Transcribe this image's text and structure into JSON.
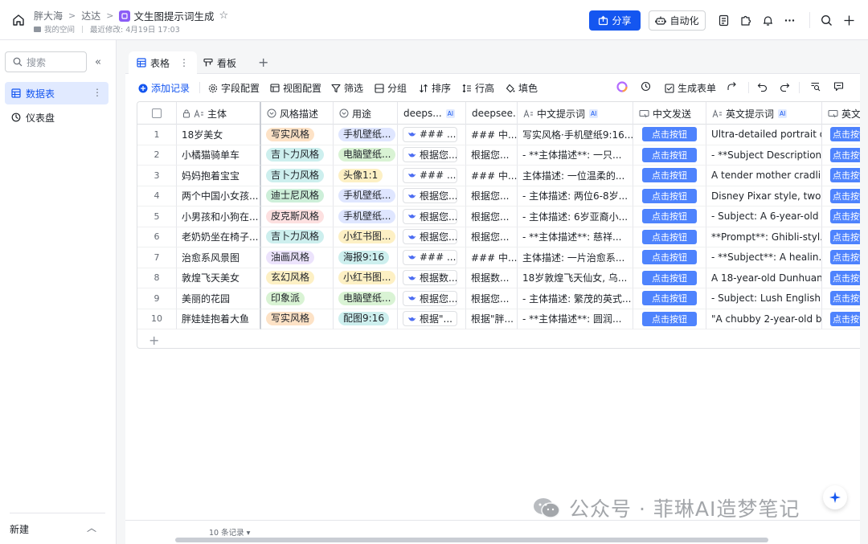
{
  "breadcrumb": [
    "胖大海",
    "达达"
  ],
  "document": {
    "title": "文生图提示词生成",
    "space": "我的空间",
    "last_modified": "最近修改: 4月19日 17:03"
  },
  "top_actions": {
    "share": "分享",
    "automation": "自动化"
  },
  "sidebar": {
    "search_placeholder": "搜索",
    "items": [
      {
        "label": "数据表",
        "active": true
      },
      {
        "label": "仪表盘",
        "active": false
      }
    ],
    "new_label": "新建"
  },
  "view_tabs": [
    {
      "label": "表格",
      "active": true
    },
    {
      "label": "看板",
      "active": false
    }
  ],
  "toolbar": {
    "add_record": "添加记录",
    "field_config": "字段配置",
    "view_config": "视图配置",
    "filter": "筛选",
    "group": "分组",
    "sort": "排序",
    "row_height": "行高",
    "fill_color": "填色",
    "generate_form": "生成表单"
  },
  "columns": {
    "subject": "主体",
    "style": "风格描述",
    "usage": "用途",
    "deeps1": "deeps...",
    "deeps2": "deepsee...",
    "cn_prompt": "中文提示词",
    "cn_send": "中文发送",
    "en_prompt": "英文提示词",
    "en_send": "英文"
  },
  "ai_badge": "AI",
  "rows": [
    {
      "no": "1",
      "subject": "18岁美女",
      "style": "写实风格",
      "style_color": "#fde2c6",
      "usage": "手机壁纸...",
      "usage_color": "#dfe6ff",
      "deeps1": "### ...",
      "deeps2": "### 中...",
      "cn": "写实风格·手机壁纸9:16...",
      "btn": "点击按钮",
      "en": "Ultra-detailed portrait of..."
    },
    {
      "no": "2",
      "subject": "小橘猫骑单车",
      "style": "吉卜力风格",
      "style_color": "#cdefee",
      "usage": "电脑壁纸...",
      "usage_color": "#d9f3d4",
      "deeps1": "根据您...",
      "deeps2": "根据您...",
      "cn": "- **主体描述**: 一只...",
      "btn": "点击按钮",
      "en": "- **Subject Description..."
    },
    {
      "no": "3",
      "subject": "妈妈抱着宝宝",
      "style": "吉卜力风格",
      "style_color": "#cdefee",
      "usage": "头像1:1",
      "usage_color": "#fdf0c4",
      "deeps1": "### ...",
      "deeps2": "### 中...",
      "cn": "主体描述: 一位温柔的...",
      "btn": "点击按钮",
      "en": "A tender mother cradlin..."
    },
    {
      "no": "4",
      "subject": "两个中国小女孩...",
      "style": "迪士尼风格",
      "style_color": "#cdefd9",
      "usage": "手机壁纸...",
      "usage_color": "#dfe6ff",
      "deeps1": "根据您...",
      "deeps2": "根据您...",
      "cn": "- 主体描述: 两位6-8岁...",
      "btn": "点击按钮",
      "en": "Disney Pixar style, two ..."
    },
    {
      "no": "5",
      "subject": "小男孩和小狗在...",
      "style": "皮克斯风格",
      "style_color": "#fde0e0",
      "usage": "手机壁纸...",
      "usage_color": "#dfe6ff",
      "deeps1": "根据您...",
      "deeps2": "根据您...",
      "cn": "- 主体描述: 6岁亚裔小...",
      "btn": "点击按钮",
      "en": "- Subject: A 6-year-old ..."
    },
    {
      "no": "6",
      "subject": "老奶奶坐在椅子...",
      "style": "吉卜力风格",
      "style_color": "#cdefee",
      "usage": "小红书图...",
      "usage_color": "#fdf0c4",
      "deeps1": "根据您...",
      "deeps2": "根据您...",
      "cn": "- **主体描述**: 慈祥...",
      "btn": "点击按钮",
      "en": "**Prompt**: Ghibli-styl..."
    },
    {
      "no": "7",
      "subject": "治愈系风景图",
      "style": "油画风格",
      "style_color": "#ece3fc",
      "usage": "海报9:16",
      "usage_color": "#cdefee",
      "deeps1": "### ...",
      "deeps2": "### 中...",
      "cn": "主体描述: 一片治愈系...",
      "btn": "点击按钮",
      "en": "- **Subject**: A healin..."
    },
    {
      "no": "8",
      "subject": "敦煌飞天美女",
      "style": "玄幻风格",
      "style_color": "#fdf0c4",
      "usage": "小红书图...",
      "usage_color": "#fdf0c4",
      "deeps1": "根据数...",
      "deeps2": "根据数...",
      "cn": "18岁敦煌飞天仙女, 乌...",
      "btn": "点击按钮",
      "en": "A 18-year-old Dunhuang..."
    },
    {
      "no": "9",
      "subject": "美丽的花园",
      "style": "印象派",
      "style_color": "#d9f3d4",
      "usage": "电脑壁纸...",
      "usage_color": "#d9f3d4",
      "deeps1": "根据您...",
      "deeps2": "根据您...",
      "cn": "- 主体描述: 繁茂的英式...",
      "btn": "点击按钮",
      "en": "- Subject: Lush English ..."
    },
    {
      "no": "10",
      "subject": "胖娃娃抱着大鱼",
      "style": "写实风格",
      "style_color": "#fde2c6",
      "usage": "配图9:16",
      "usage_color": "#cdefee",
      "deeps1": "根据\"...",
      "deeps2": "根据\"胖...",
      "cn": "- **主体描述**: 圆润...",
      "btn": "点击按钮",
      "en": "\"A chubby 2-year-old ba..."
    }
  ],
  "footer": {
    "record_count": "10 条记录"
  },
  "watermark": "公众号 · 菲琳AI造梦笔记",
  "colors": {
    "accent": "#1456f0",
    "button": "#4e83fd"
  }
}
